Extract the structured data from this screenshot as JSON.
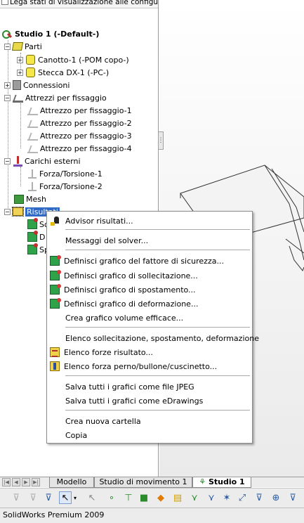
{
  "panel": {
    "top_text": "Lega stati di visualizzazione alle configurazi",
    "study": "Studio 1 (-Default-)",
    "parts": "Parti",
    "part_items": [
      "Canotto-1 (-POM copo-)",
      "Stecca DX-1 (-PC-)"
    ],
    "connections": "Connessioni",
    "fixtures": "Attrezzi per fissaggio",
    "fixture_items": [
      "Attrezzo per fissaggio-1",
      "Attrezzo per fissaggio-2",
      "Attrezzo per fissaggio-3",
      "Attrezzo per fissaggio-4"
    ],
    "loads": "Carichi esterni",
    "load_items": [
      "Forza/Torsione-1",
      "Forza/Torsione-2"
    ],
    "mesh": "Mesh",
    "results": "Risultati",
    "result_items": [
      "So",
      "D",
      "Sp"
    ]
  },
  "menu": {
    "items": [
      "Advisor risultati...",
      "Messaggi del solver...",
      "Definisci grafico del fattore di sicurezza...",
      "Definisci grafico di sollecitazione...",
      "Definisci grafico di spostamento...",
      "Definisci grafico di deformazione...",
      "Crea grafico volume efficace...",
      "Elenco sollecitazione, spostamento, deformazione",
      "Elenco forze risultato...",
      "Elenco forza perno/bullone/cuscinetto...",
      "Salva tutti i grafici come file JPEG",
      "Salva tutti i grafici come eDrawings",
      "Crea nuova cartella",
      "Copia"
    ]
  },
  "tabs": [
    "Modello",
    "Studio di movimento 1",
    "Studio 1"
  ],
  "status": "SolidWorks Premium 2009"
}
